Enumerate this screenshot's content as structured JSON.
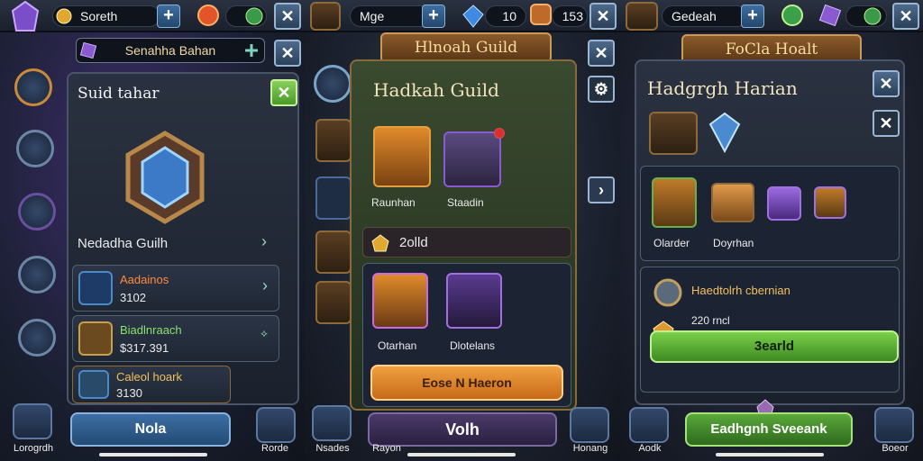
{
  "screen1": {
    "top": {
      "name": "Soreth",
      "plus": "+"
    },
    "sub_header": "Senahha Bahan",
    "panel_title": "Suid tahar",
    "artifact_name": "Nedadha Guilh",
    "rows": [
      {
        "title": "Aadainos",
        "value": "3102"
      },
      {
        "title": "Biadlnraach",
        "value": "$317.391"
      },
      {
        "title": "Caleol hoark",
        "value": "3130"
      }
    ],
    "bottom_button": "Nola",
    "tabs": [
      "Lorogrdh",
      "Rorde"
    ]
  },
  "screen2": {
    "top": {
      "name": "Mge",
      "val1": "10",
      "val2": "153"
    },
    "banner": "Hlnoah Guild",
    "title": "Hadkah Guild",
    "items": [
      "Raunhan",
      "Staadin"
    ],
    "gold_label": "2olld",
    "items2": [
      "Otarhan",
      "Dlotelans"
    ],
    "action_button": "Eose N Haeron",
    "bottom_button": "Volh",
    "tabs": [
      "Nsades",
      "Rayon",
      "Honang"
    ]
  },
  "screen3": {
    "top": {
      "name": "Gedeah"
    },
    "banner": "FoCla Hoalt",
    "title": "Hadgrgh Harian",
    "items": [
      "Olarder",
      "Doyrhan"
    ],
    "info_title": "Haedtolrh cbernian",
    "info_value": "220 rncl",
    "green_button": "3earld",
    "bottom_button": "Eadhgnh Sveeank",
    "tabs": [
      "Aodk",
      "Boeor"
    ]
  },
  "colors": {
    "accent_gold": "#f0c060",
    "green_btn": "#5fb83c",
    "orange_btn": "#e8902c",
    "purple_gem": "#8a5ad0"
  }
}
